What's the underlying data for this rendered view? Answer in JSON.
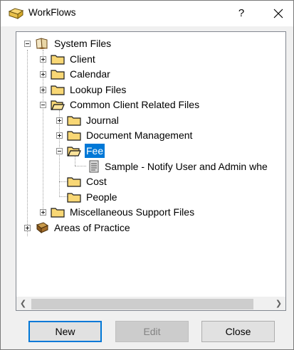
{
  "window": {
    "title": "WorkFlows",
    "help_label": "?"
  },
  "tree": {
    "nodes": [
      {
        "label": "System Files",
        "icon": "book-open-icon",
        "expanded": true
      },
      {
        "label": "Client",
        "icon": "folder-icon",
        "expanded": false
      },
      {
        "label": "Calendar",
        "icon": "folder-icon",
        "expanded": false
      },
      {
        "label": "Lookup Files",
        "icon": "folder-icon",
        "expanded": false
      },
      {
        "label": "Common Client Related Files",
        "icon": "folder-open-icon",
        "expanded": true
      },
      {
        "label": "Journal",
        "icon": "folder-icon",
        "expanded": false
      },
      {
        "label": "Document Management",
        "icon": "folder-icon",
        "expanded": false
      },
      {
        "label": "Fee",
        "icon": "folder-open-icon",
        "expanded": true,
        "selected": true
      },
      {
        "label": "Sample - Notify User and Admin whe",
        "icon": "document-icon"
      },
      {
        "label": "Cost",
        "icon": "folder-icon"
      },
      {
        "label": "People",
        "icon": "folder-icon"
      },
      {
        "label": "Miscellaneous Support Files",
        "icon": "folder-icon",
        "expanded": false
      },
      {
        "label": "Areas of Practice",
        "icon": "book-closed-icon",
        "expanded": false
      }
    ]
  },
  "buttons": {
    "new_label": "New",
    "edit_label": "Edit",
    "close_label": "Close"
  },
  "colors": {
    "selection": "#0078d7",
    "folder_fill": "#f8d775",
    "folder_stroke": "#8a6d1a"
  }
}
